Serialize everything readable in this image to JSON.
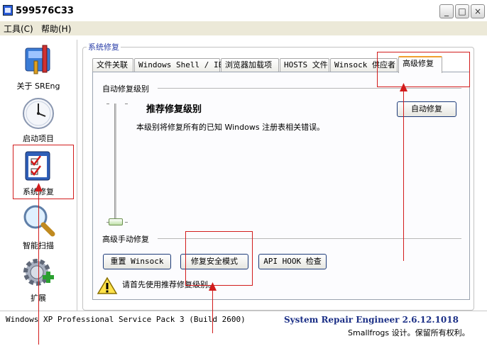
{
  "window": {
    "title": "599576C33",
    "min_glyph": "_",
    "max_glyph": "□",
    "close_glyph": "×"
  },
  "menu": [
    "工具(C)",
    "帮助(H)"
  ],
  "sidebar": [
    {
      "label": "关于 SREng",
      "icon": "toolbox-icon"
    },
    {
      "label": "启动项目",
      "icon": "clock-icon"
    },
    {
      "label": "系统修复",
      "icon": "checklist-icon"
    },
    {
      "label": "智能扫描",
      "icon": "magnifier-icon"
    },
    {
      "label": "扩展",
      "icon": "gear-plus-icon"
    }
  ],
  "group_title": "系统修复",
  "tabs": [
    "文件关联",
    "Windows Shell / IE",
    "浏览器加载项",
    "HOSTS 文件",
    "Winsock 供应者",
    "高级修复"
  ],
  "auto_repair": {
    "section_label": "自动修复级别",
    "level_title": "推荐修复级别",
    "level_desc": "本级别将修复所有的已知 Windows 注册表相关错误。",
    "button": "自动修复"
  },
  "manual_repair": {
    "section_label": "高级手动修复",
    "buttons": [
      "重置 Winsock",
      "修复安全模式",
      "API HOOK 检查"
    ],
    "warning": "请首先使用推荐修复级别。"
  },
  "status": {
    "os": "Windows XP Professional Service Pack 3 (Build 2600)",
    "product": "System Repair Engineer 2.6.12.1018",
    "copyright": "Smallfrogs 设计。保留所有权利。"
  },
  "colors": {
    "annotation": "#d21c1c",
    "tab_highlight": "#f0a030",
    "product_text": "#1b2f86"
  }
}
